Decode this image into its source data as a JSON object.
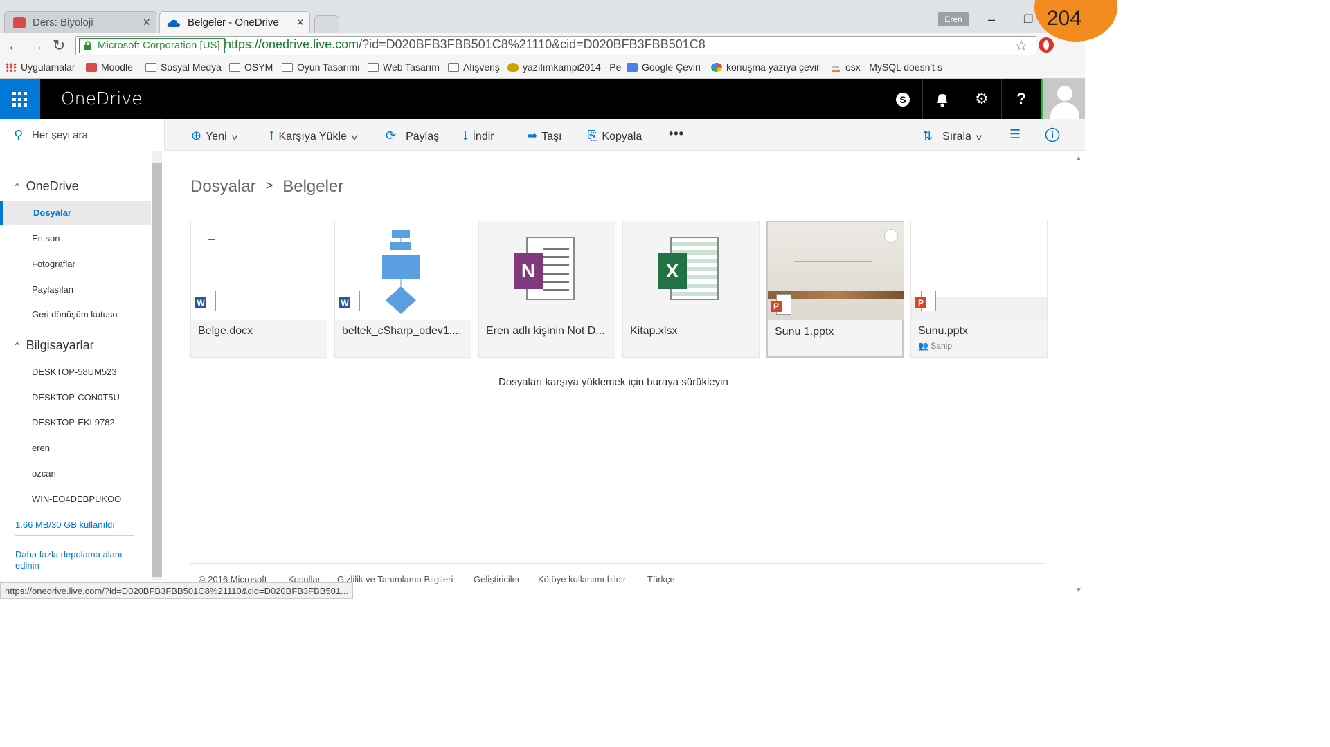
{
  "browser": {
    "tabs": [
      {
        "title": "Ders: Biyoloji"
      },
      {
        "title": "Belgeler - OneDrive"
      }
    ],
    "profile": "Eren",
    "cert": "Microsoft Corporation [US]",
    "url_scheme_host": "https://onedrive.live.com",
    "url_rest": "/?id=D020BFB3FBB501C8%21110&cid=D020BFB3FBB501C8",
    "bookmarks": [
      "Uygulamalar",
      "Moodle",
      "Sosyal Medya",
      "OSYM",
      "Oyun Tasarımı",
      "Web Tasarım",
      "Alışveriş",
      "yazılımkampi2014 - Pe",
      "Google Çeviri",
      "konuşma yazıya çevir",
      "osx - MySQL doesn't s"
    ],
    "status_url": "https://onedrive.live.com/?id=D020BFB3FBB501C8%21110&cid=D020BFB3FBB501..."
  },
  "app": {
    "brand": "OneDrive",
    "header_icons": [
      "skype-icon",
      "bell-icon",
      "gear-icon",
      "help-icon"
    ]
  },
  "commandbar": {
    "search_placeholder": "Her şeyi ara",
    "new": "Yeni",
    "upload": "Karşıya Yükle",
    "share": "Paylaş",
    "download": "İndir",
    "move": "Taşı",
    "copy": "Kopyala",
    "more": "•••",
    "sort": "Sırala"
  },
  "nav": {
    "onedrive_group": "OneDrive",
    "onedrive_items": [
      "Dosyalar",
      "En son",
      "Fotoğraflar",
      "Paylaşılan",
      "Geri dönüşüm kutusu"
    ],
    "pcs_group": "Bilgisayarlar",
    "pcs": [
      "DESKTOP-58UM523",
      "DESKTOP-CON0T5U",
      "DESKTOP-EKL9782",
      "eren",
      "ozcan",
      "WIN-EO4DEBPUKOO"
    ],
    "quota": "1.66 MB/30 GB kullanıldı",
    "get_storage": "Daha fazla depolama alanı edinin"
  },
  "main": {
    "breadcrumb": [
      "Dosyalar",
      "Belgeler"
    ],
    "files": [
      {
        "name": "Belge.docx",
        "sub": ""
      },
      {
        "name": "beltek_cSharp_odev1....",
        "sub": ""
      },
      {
        "name": "Eren adlı kişinin Not D...",
        "sub": ""
      },
      {
        "name": "Kitap.xlsx",
        "sub": ""
      },
      {
        "name": "Sunu 1.pptx",
        "sub": ""
      },
      {
        "name": "Sunu.pptx",
        "sub": "Sahip"
      }
    ],
    "drop_hint": "Dosyaları karşıya yüklemek için buraya sürükleyin",
    "footer": [
      "© 2016 Microsoft",
      "Koşullar",
      "Gizlilik ve Tanımlama Bilgileri",
      "Geliştiriciler",
      "Kötüye kullanımı bildir",
      "Türkçe"
    ]
  },
  "slide_number": "204",
  "colors": {
    "accent": "#0078d7",
    "header": "#000000",
    "word": "#2b579a",
    "powerpoint": "#d24726",
    "excel": "#217346",
    "onenote": "#80397b"
  }
}
